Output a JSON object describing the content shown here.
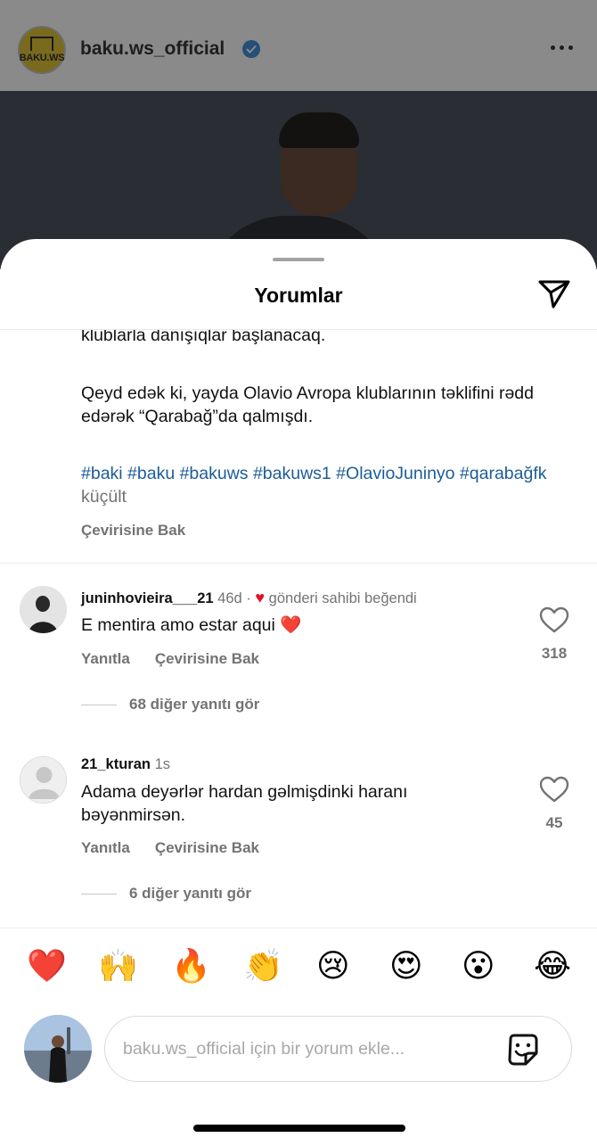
{
  "post": {
    "account_logo_text": "BAKU.WS",
    "username": "baku.ws_official",
    "verified": true,
    "more_icon": "ellipsis-icon"
  },
  "sheet": {
    "title": "Yorumlar",
    "share_icon": "paper-plane-icon",
    "caption_clipped_line": "klublarla danışıqlar başlanacaq.",
    "caption_paragraph": "Qeyd edək ki, yayda Olavio Avropa klublarının təklifini rədd edərək “Qarabağ”da qalmışdı.",
    "hashtags": "#baki #baku #bakuws #bakuws1 #OlavioJuninyo #qarabağfk",
    "less_label": "küçült",
    "see_translation": "Çevirisine Bak"
  },
  "comments": [
    {
      "username": "juninhovieira___21",
      "time": "46d",
      "liked_by_author": "gönderi sahibi beğendi",
      "text": "E mentira amo estar aqui ❤️",
      "reply_label": "Yanıtla",
      "translate_label": "Çevirisine Bak",
      "likes": "318",
      "view_replies": "68 diğer yanıtı gör"
    },
    {
      "username": "21_kturan",
      "time": "1s",
      "text": "Adama deyərlər hardan gəlmişdinki haranı bəyənmirsən.",
      "reply_label": "Yanıtla",
      "translate_label": "Çevirisine Bak",
      "likes": "45",
      "view_replies": "6 diğer yanıtı gör"
    }
  ],
  "emoji_bar": [
    "❤️",
    "🙌",
    "🔥",
    "👏",
    "😢",
    "😍",
    "😮",
    "😂"
  ],
  "composer": {
    "placeholder": "baku.ws_official için bir yorum ekle...",
    "sticker_icon": "sticker-icon"
  },
  "colors": {
    "link": "#1c5d96",
    "secondary_text": "#737373",
    "like_red": "#e0112b"
  }
}
